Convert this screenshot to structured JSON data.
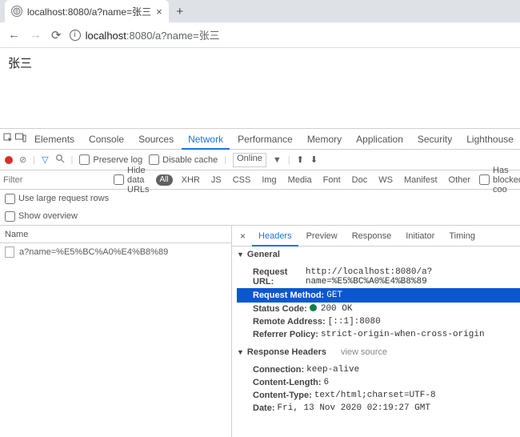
{
  "browser": {
    "tab_title": "localhost:8080/a?name=张三",
    "url_proto_host": "localhost",
    "url_rest": ":8080/a?name=张三",
    "new_tab": "+",
    "close": "×"
  },
  "page": {
    "body_text": "张三"
  },
  "devtools": {
    "tabs": [
      "Elements",
      "Console",
      "Sources",
      "Network",
      "Performance",
      "Memory",
      "Application",
      "Security",
      "Lighthouse"
    ],
    "active_tab_index": 3,
    "toolbar": {
      "preserve_log": "Preserve log",
      "disable_cache": "Disable cache",
      "throttle": "Online"
    },
    "filterbar": {
      "filter_placeholder": "Filter",
      "hide_data_urls": "Hide data URLs",
      "all": "All",
      "types": [
        "XHR",
        "JS",
        "CSS",
        "Img",
        "Media",
        "Font",
        "Doc",
        "WS",
        "Manifest",
        "Other"
      ],
      "has_blocked": "Has blocked coo"
    },
    "options": {
      "use_large": "Use large request rows",
      "show_overview": "Show overview"
    },
    "name_header": "Name",
    "requests": [
      {
        "name": "a?name=%E5%BC%A0%E4%B8%89"
      }
    ],
    "detail_tabs": [
      "Headers",
      "Preview",
      "Response",
      "Initiator",
      "Timing"
    ],
    "detail_active_index": 0,
    "sections": {
      "general": {
        "title": "General",
        "request_url_k": "Request URL:",
        "request_url_v": "http://localhost:8080/a?name=%E5%BC%A0%E4%B8%89",
        "request_method_k": "Request Method:",
        "request_method_v": "GET",
        "status_code_k": "Status Code:",
        "status_code_v": "200 OK",
        "remote_addr_k": "Remote Address:",
        "remote_addr_v": "[::1]:8080",
        "referrer_k": "Referrer Policy:",
        "referrer_v": "strict-origin-when-cross-origin"
      },
      "response_headers": {
        "title": "Response Headers",
        "view_source": "view source",
        "connection_k": "Connection:",
        "connection_v": "keep-alive",
        "content_length_k": "Content-Length:",
        "content_length_v": "6",
        "content_type_k": "Content-Type:",
        "content_type_v": "text/html;charset=UTF-8",
        "date_k": "Date:",
        "date_v": "Fri, 13 Nov 2020 02:19:27 GMT"
      }
    }
  }
}
